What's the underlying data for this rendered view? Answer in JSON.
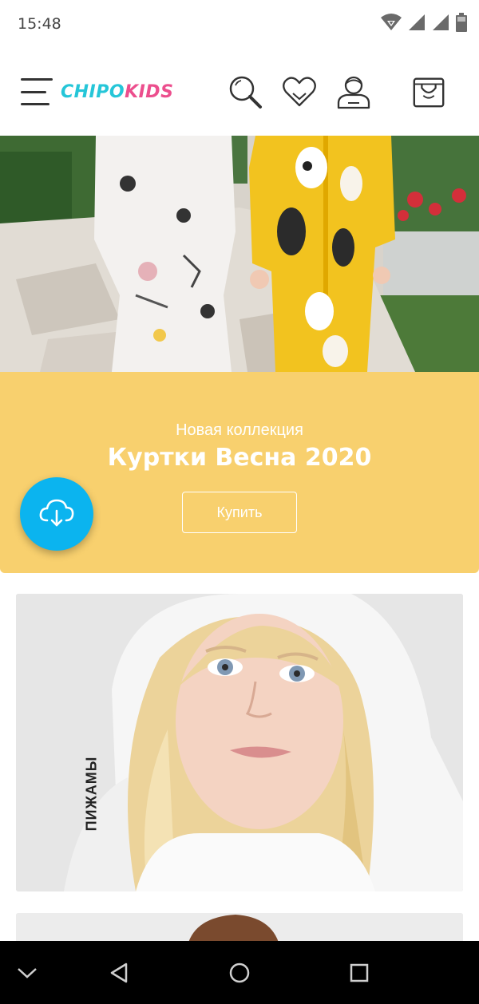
{
  "status_bar": {
    "time": "15:48",
    "icons": [
      "wifi-icon",
      "signal-icon",
      "signal-icon",
      "battery-icon"
    ]
  },
  "header": {
    "logo_part1": "CHIPO",
    "logo_part2": "KIDS",
    "logo_colors": {
      "chipo": "#25c6d8",
      "kids": "#ec4e8d"
    },
    "icons": [
      "menu-icon",
      "search-icon",
      "heart-icon",
      "user-icon",
      "cart-icon"
    ]
  },
  "hero": {
    "subtitle": "Новая коллекция",
    "title": "Куртки Весна 2020",
    "button_label": "Купить",
    "banner_color": "#f8d06e"
  },
  "fab": {
    "icon": "cloud-download-icon",
    "color": "#0bb4ef"
  },
  "categories": [
    {
      "label": "ПИЖАМЫ"
    }
  ],
  "nav_bar": {
    "icons": [
      "chevron-down-icon",
      "back-icon",
      "home-icon",
      "recents-icon"
    ]
  }
}
